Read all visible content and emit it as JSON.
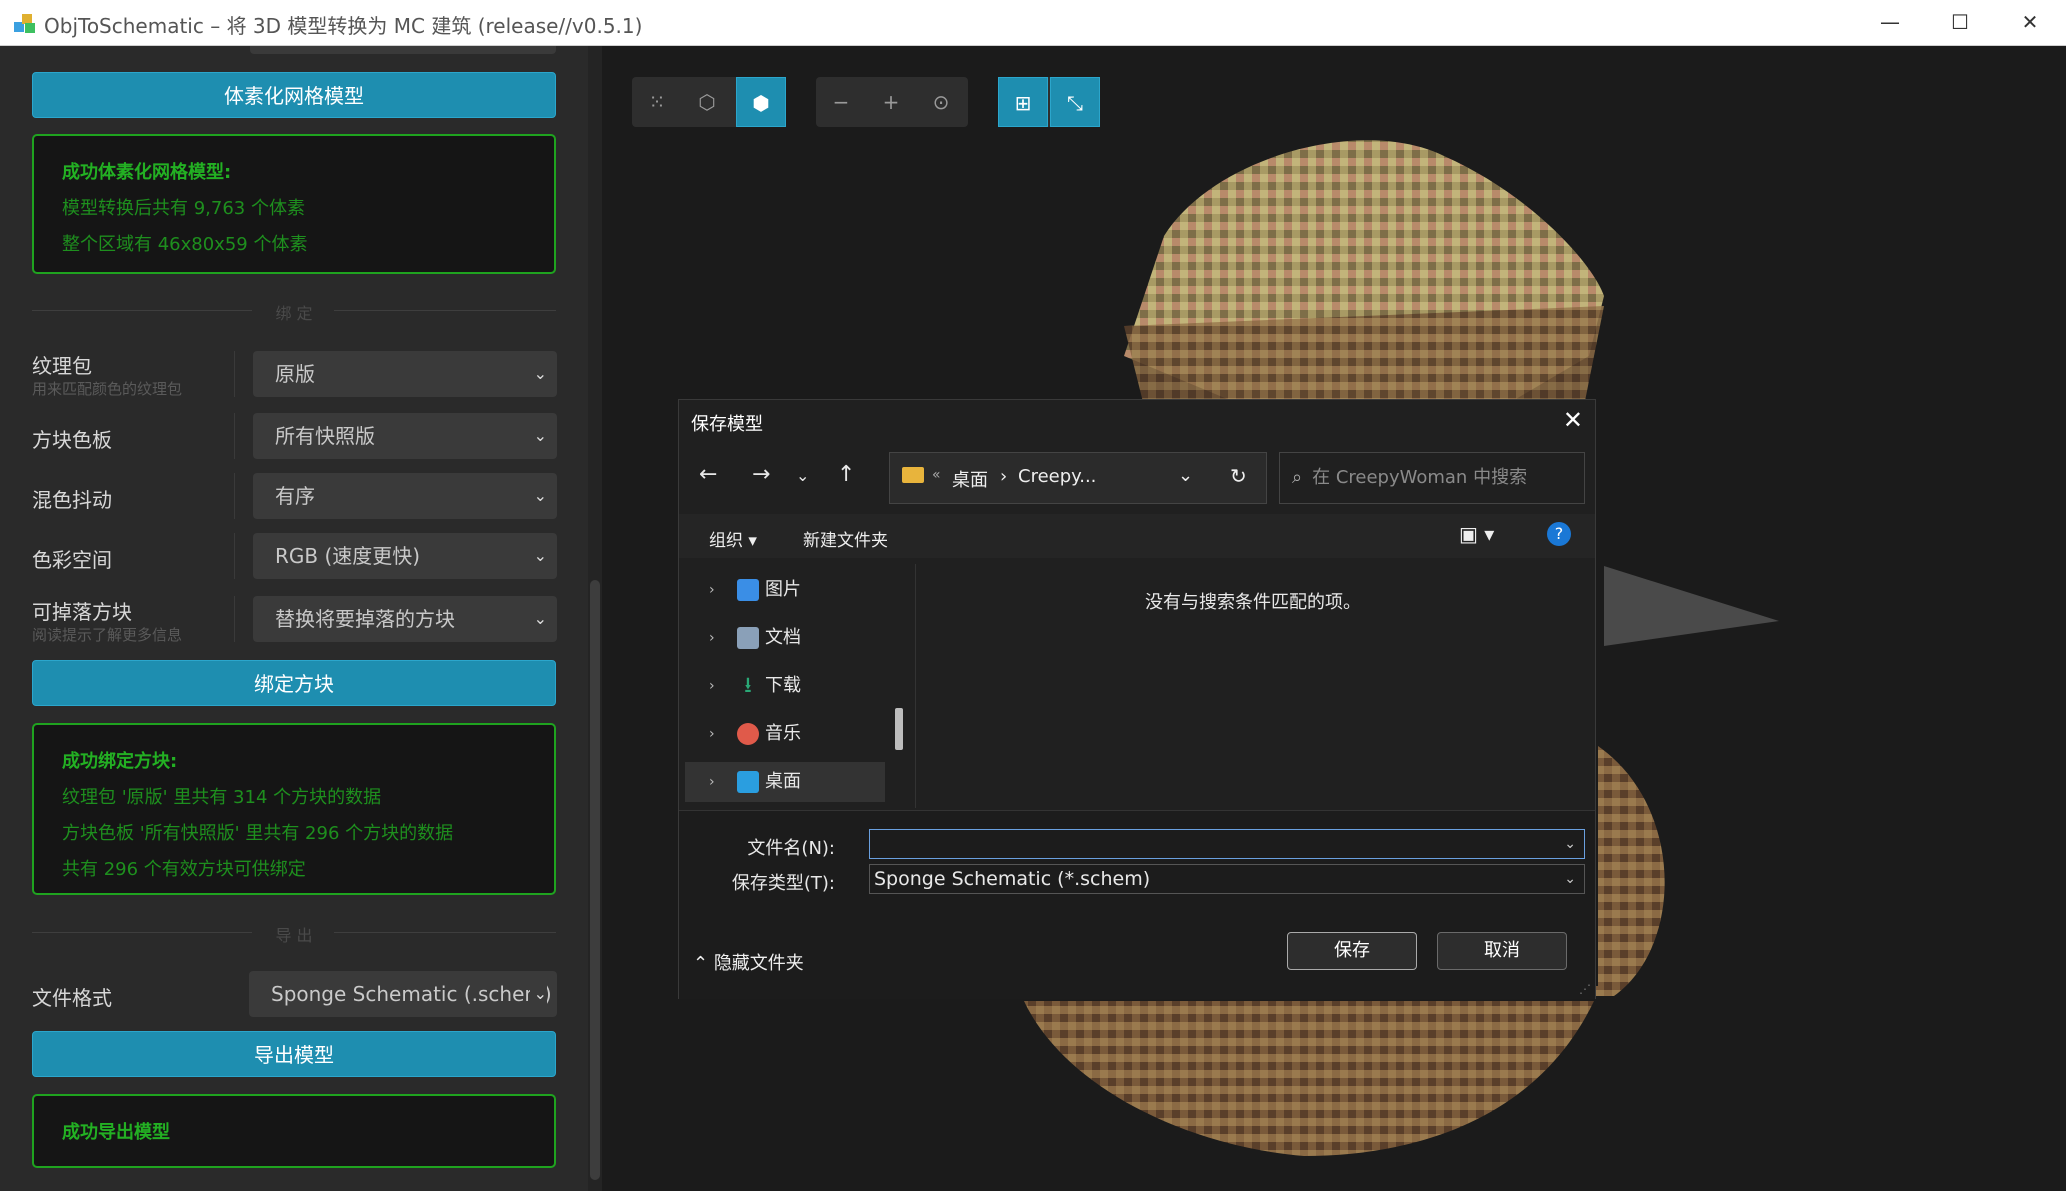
{
  "window": {
    "title": "ObjToSchematic – 将 3D 模型转换为 MC 建筑 (release//v0.5.1)",
    "minimize": "—",
    "maximize": "☐",
    "close": "✕"
  },
  "sidebar": {
    "voxelize_button": "体素化网格模型",
    "voxelize_msg": {
      "heading": "成功体素化网格模型:",
      "lines": [
        "模型转换后共有 9,763 个体素",
        "整个区域有 46x80x59 个体素"
      ]
    },
    "assign_divider": "绑 定",
    "rows": [
      {
        "label": "纹理包",
        "sub": "用来匹配颜色的纹理包",
        "value": "原版"
      },
      {
        "label": "方块色板",
        "sub": "",
        "value": "所有快照版"
      },
      {
        "label": "混色抖动",
        "sub": "",
        "value": "有序"
      },
      {
        "label": "色彩空间",
        "sub": "",
        "value": "RGB (速度更快)"
      },
      {
        "label": "可掉落方块",
        "sub": "阅读提示了解更多信息",
        "value": "替换将要掉落的方块"
      }
    ],
    "assign_button": "绑定方块",
    "assign_msg": {
      "heading": "成功绑定方块:",
      "lines": [
        "纹理包 '原版' 里共有 314 个方块的数据",
        "方块色板 '所有快照版' 里共有 296 个方块的数据",
        "共有 296 个有效方块可供绑定"
      ]
    },
    "export_divider": "导 出",
    "file_format_label": "文件格式",
    "file_format_value": "Sponge Schematic (.schem)",
    "export_button": "导出模型",
    "export_msg": {
      "heading": "成功导出模型"
    }
  },
  "toolbar": {
    "icons": [
      "points-icon",
      "mesh-icon",
      "voxel-cube-icon",
      "zoom-out-icon",
      "zoom-in-icon",
      "recenter-icon",
      "grid-icon",
      "axes-icon"
    ]
  },
  "dialog": {
    "title": "保存模型",
    "address": {
      "prefix": "«",
      "crumb1": "桌面",
      "sep": "›",
      "crumb2": "Creepy..."
    },
    "search_placeholder": "在 CreepyWoman 中搜索",
    "organize": "组织",
    "new_folder": "新建文件夹",
    "tree": [
      {
        "label": "图片",
        "color": "#3a8ee6"
      },
      {
        "label": "文档",
        "color": "#8aa0b8"
      },
      {
        "label": "下载",
        "color": "#2aa876"
      },
      {
        "label": "音乐",
        "color": "#e05a4a"
      },
      {
        "label": "桌面",
        "color": "#2a9ee0"
      }
    ],
    "empty_message": "没有与搜索条件匹配的项。",
    "filename_label": "文件名(N):",
    "filename_value": "",
    "filetype_label": "保存类型(T):",
    "filetype_value": "Sponge Schematic (*.schem)",
    "hide_folders": "隐藏文件夹",
    "save_button": "保存",
    "cancel_button": "取消"
  }
}
